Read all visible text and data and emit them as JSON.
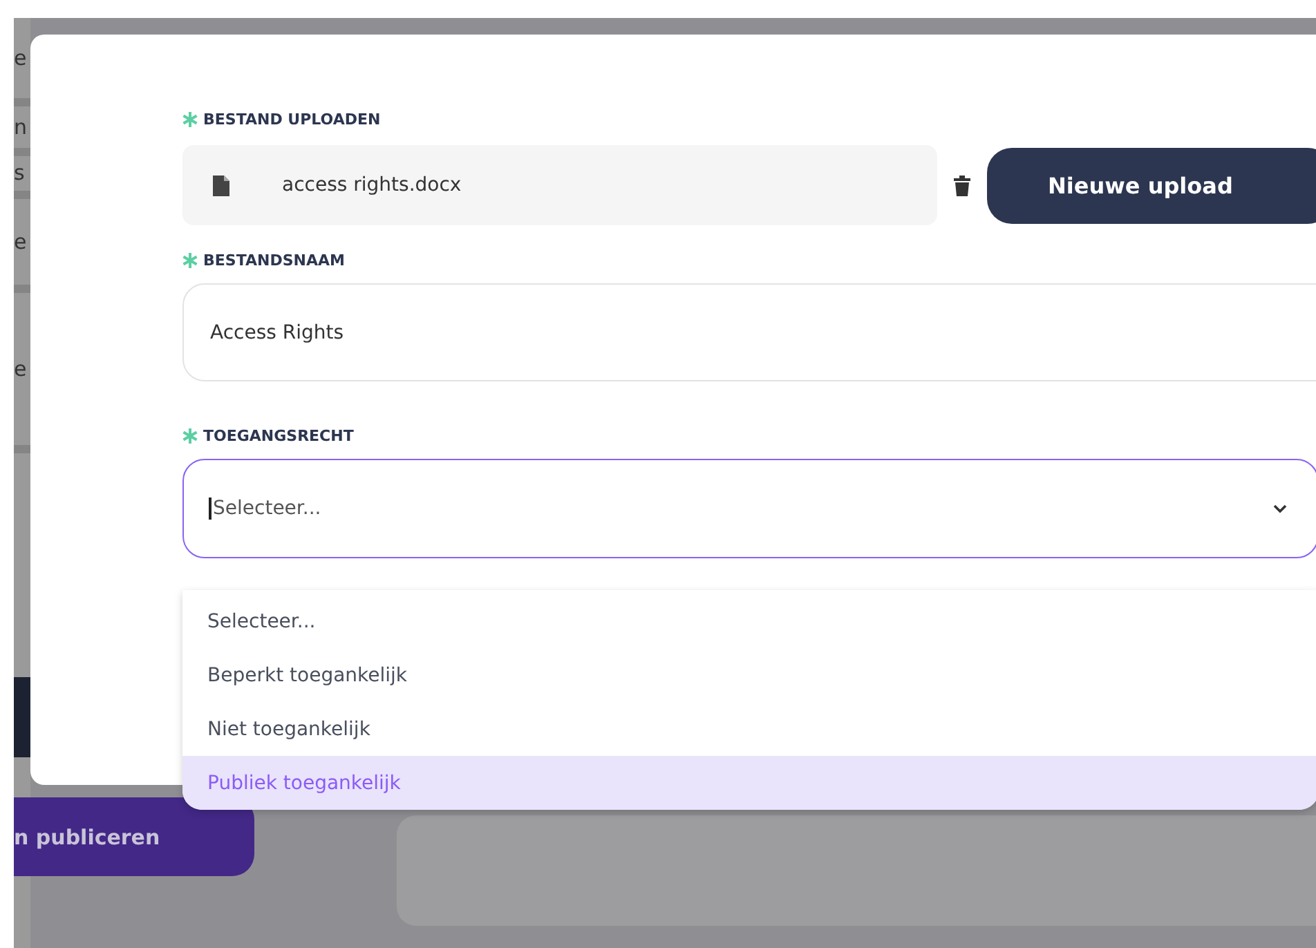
{
  "background": {
    "sidebar_fragments": [
      "e",
      "n",
      "s",
      "e",
      "e"
    ],
    "publish_button": "n publiceren"
  },
  "dialog": {
    "fields": [
      {
        "kind": "upload",
        "label": "BESTAND UPLOADEN",
        "required": true,
        "file_name": "access rights.docx",
        "button": "Nieuwe upload"
      },
      {
        "kind": "text",
        "label": "BESTANDSNAAM",
        "required": true,
        "value": "Access Rights"
      },
      {
        "kind": "select",
        "label": "TOEGANGSRECHT",
        "required": true,
        "placeholder": "Selecteer...",
        "expanded": true,
        "options": [
          {
            "label": "Selecteer...",
            "selected": false
          },
          {
            "label": "Beperkt toegankelijk",
            "selected": false
          },
          {
            "label": "Niet toegankelijk",
            "selected": false
          },
          {
            "label": "Publiek toegankelijk",
            "selected": true
          }
        ]
      }
    ]
  }
}
